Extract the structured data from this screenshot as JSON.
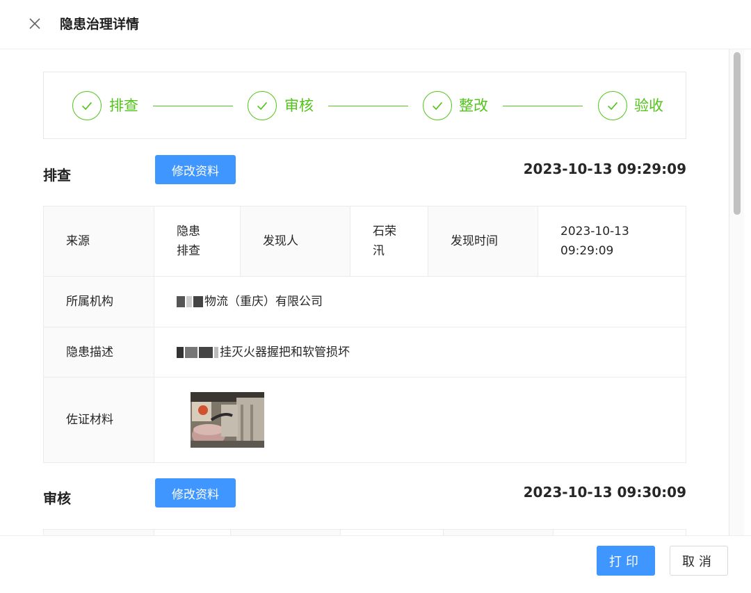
{
  "header": {
    "title": "隐患治理详情"
  },
  "steps": [
    {
      "label": "排查"
    },
    {
      "label": "审核"
    },
    {
      "label": "整改"
    },
    {
      "label": "验收"
    }
  ],
  "inspection": {
    "title": "排查",
    "edit_label": "修改资料",
    "timestamp": "2023-10-13 09:29:09",
    "source_label": "来源",
    "source_value": "隐患排查",
    "finder_label": "发现人",
    "finder_value": "石荣汛",
    "found_time_label": "发现时间",
    "found_time_value": "2023-10-13 09:29:09",
    "org_label": "所属机构",
    "org_value": "物流（重庆）有限公司",
    "desc_label": "隐患描述",
    "desc_value": "挂灭火器握把和软管损坏",
    "evidence_label": "佐证材料"
  },
  "review": {
    "title": "审核",
    "edit_label": "修改资料",
    "timestamp": "2023-10-13 09:30:09"
  },
  "footer": {
    "print_label": "打印",
    "cancel_label": "取消"
  },
  "colors": {
    "primary": "#4096ff",
    "success": "#52c41a"
  }
}
